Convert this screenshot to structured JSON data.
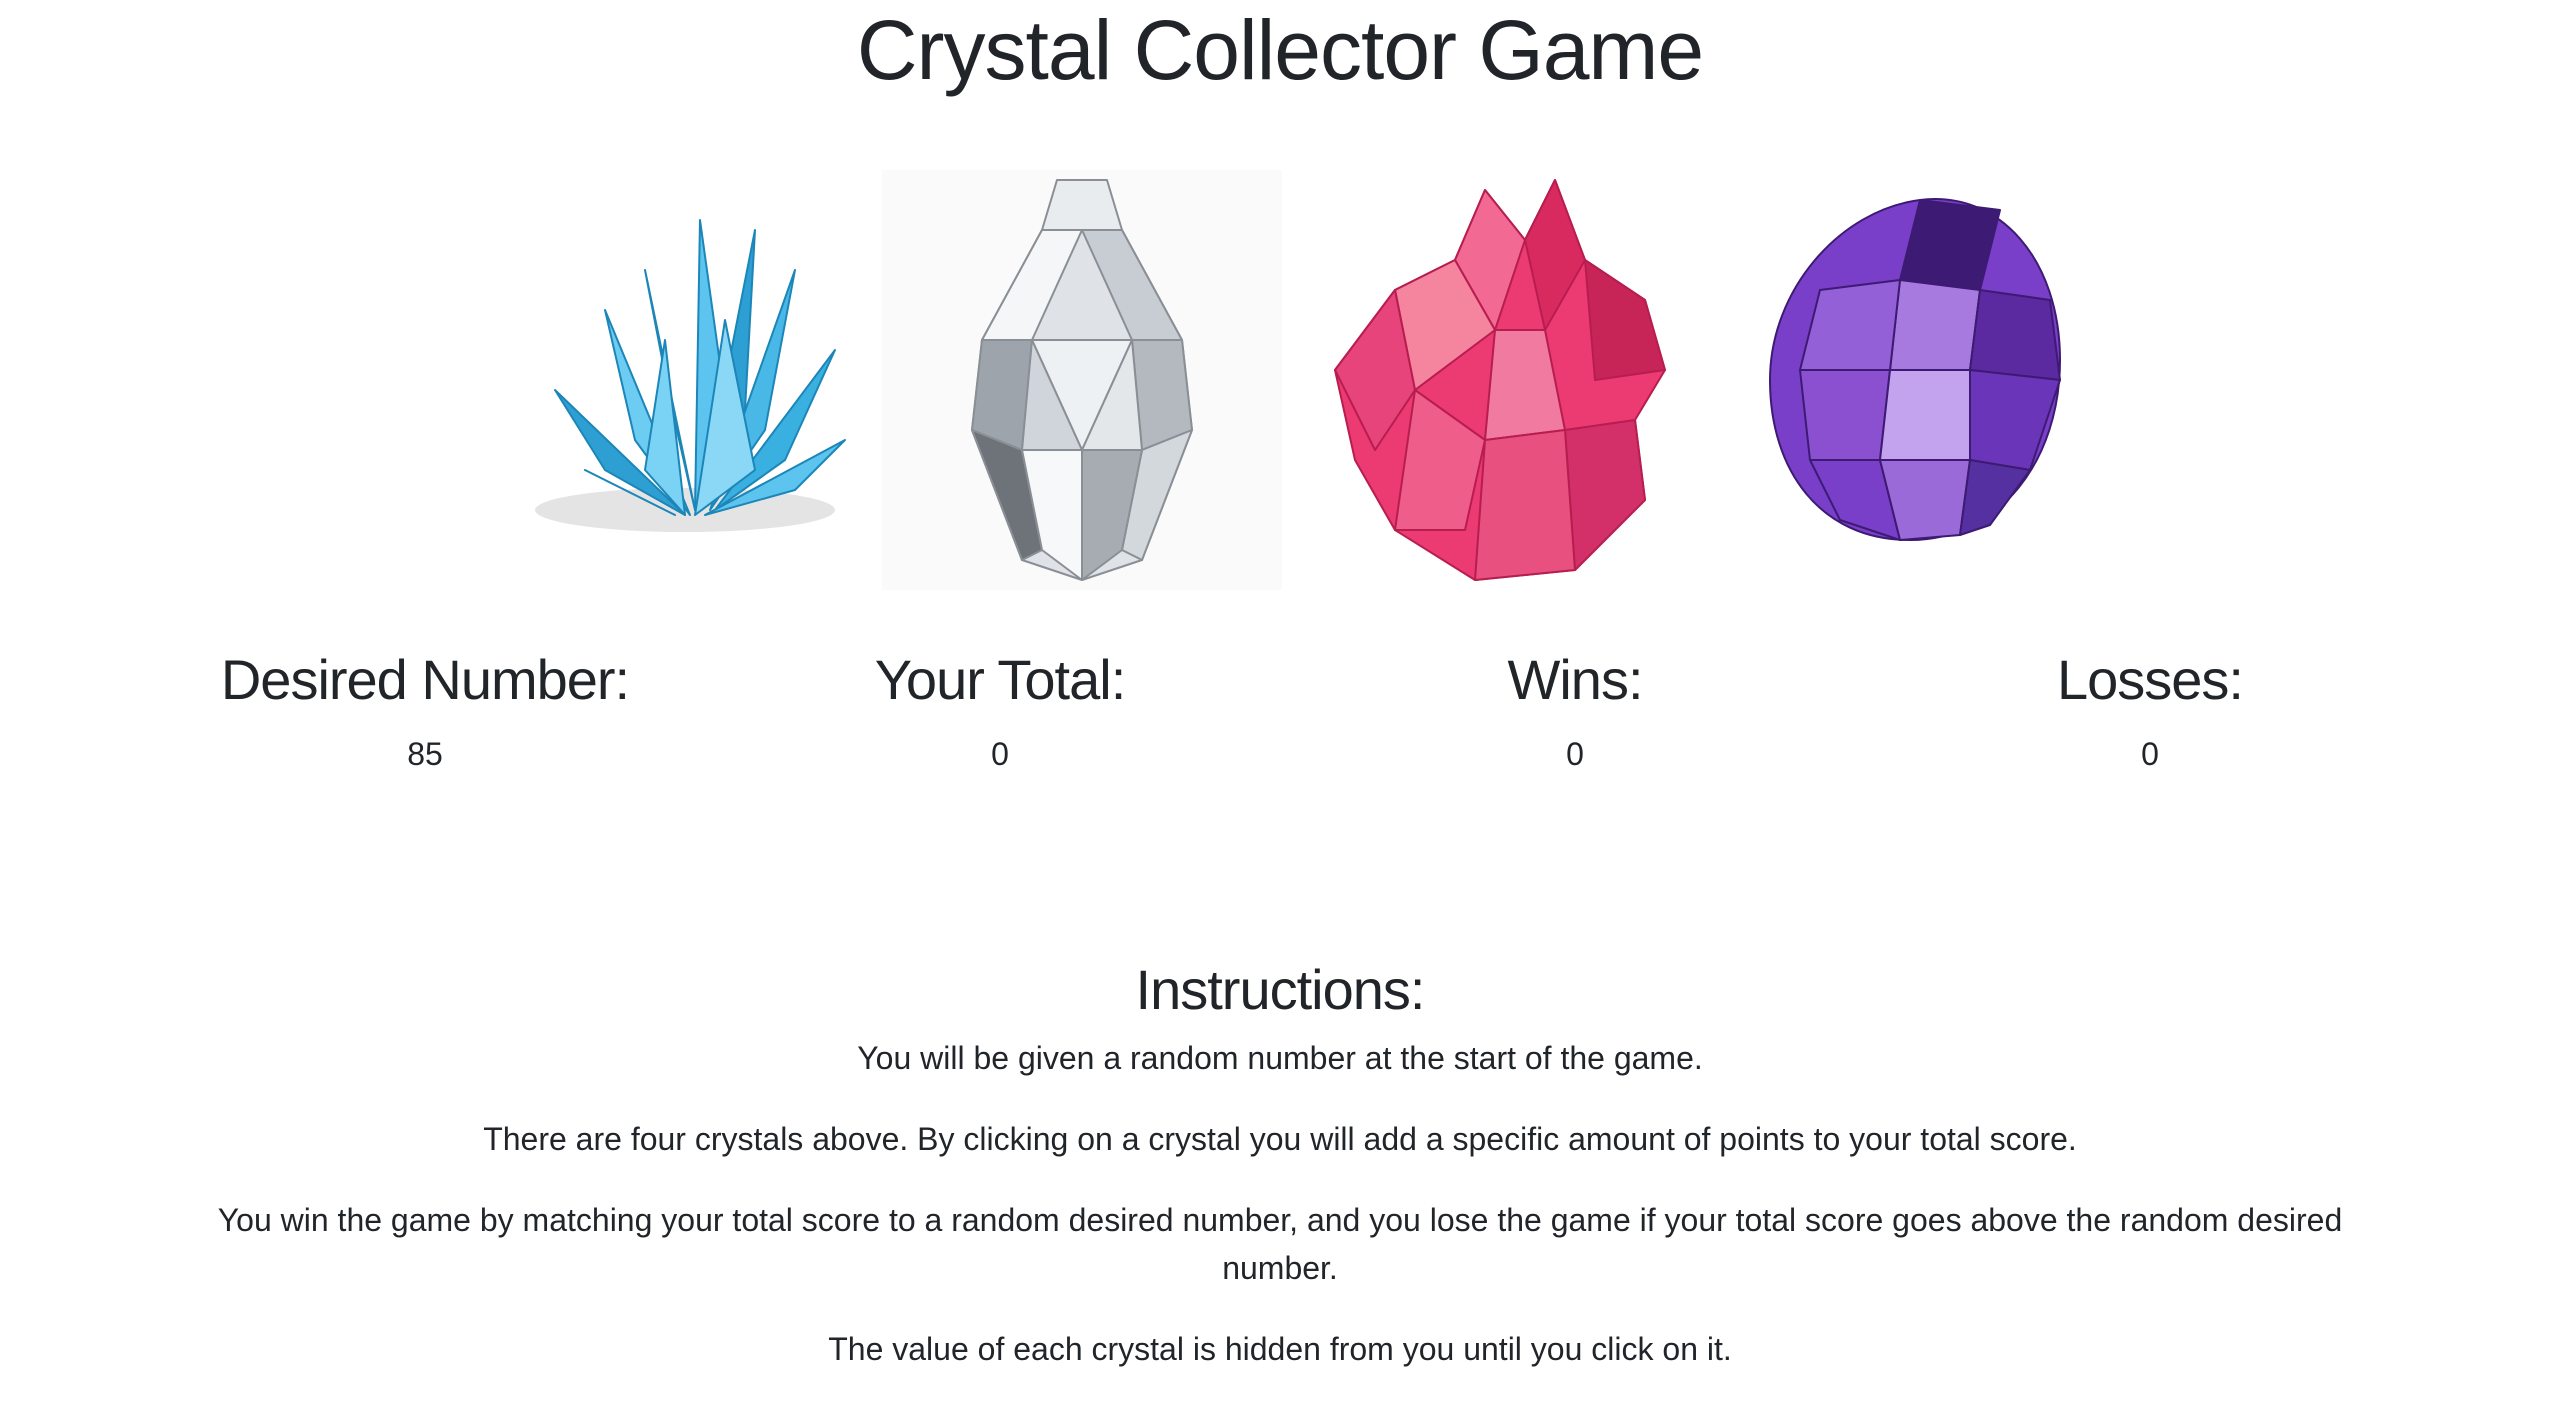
{
  "title": "Crystal Collector Game",
  "crystals": [
    {
      "name": "blue crystal cluster",
      "color": "#3ab0e0"
    },
    {
      "name": "clear crystal drop",
      "color": "#d8dce0"
    },
    {
      "name": "pink crystal",
      "color": "#ec3a72"
    },
    {
      "name": "purple crystal ball",
      "color": "#7a3fc8"
    }
  ],
  "stats": {
    "desired": {
      "label": "Desired Number:",
      "value": "85"
    },
    "total": {
      "label": "Your Total:",
      "value": "0"
    },
    "wins": {
      "label": "Wins:",
      "value": "0"
    },
    "losses": {
      "label": "Losses:",
      "value": "0"
    }
  },
  "instructions": {
    "title": "Instructions:",
    "paragraphs": [
      "You will be given a random number at the start of the game.",
      "There are four crystals above. By clicking on a crystal you will add a specific amount of points to your total score.",
      "You win the game by matching your total score to a random desired number, and you lose the game if your total score goes above the random desired number.",
      "The value of each crystal is hidden from you until you click on it."
    ]
  }
}
